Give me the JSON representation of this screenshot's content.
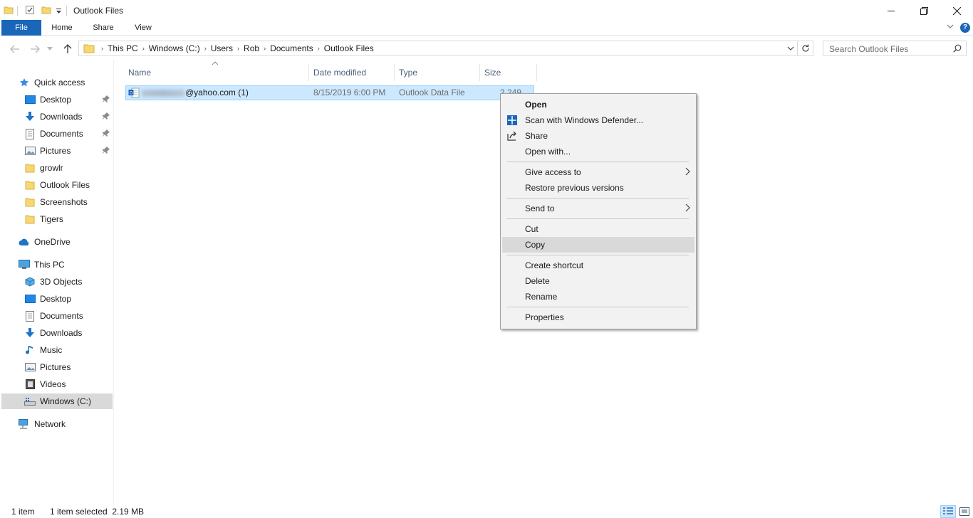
{
  "window": {
    "title": "Outlook Files"
  },
  "ribbon": {
    "tabs": [
      "File",
      "Home",
      "Share",
      "View"
    ],
    "help_label": "?"
  },
  "address": {
    "crumbs": [
      "This PC",
      "Windows (C:)",
      "Users",
      "Rob",
      "Documents",
      "Outlook Files"
    ],
    "separator": "›"
  },
  "search": {
    "placeholder": "Search Outlook Files"
  },
  "nav": {
    "quick_access": "Quick access",
    "quick_items": [
      "Desktop",
      "Downloads",
      "Documents",
      "Pictures",
      "growlr",
      "Outlook Files",
      "Screenshots",
      "Tigers"
    ],
    "onedrive": "OneDrive",
    "this_pc": "This PC",
    "pc_items": [
      "3D Objects",
      "Desktop",
      "Documents",
      "Downloads",
      "Music",
      "Pictures",
      "Videos",
      "Windows (C:)"
    ],
    "network": "Network"
  },
  "columns": {
    "name": "Name",
    "date": "Date modified",
    "type": "Type",
    "size": "Size"
  },
  "file": {
    "name_suffix": "@yahoo.com (1)",
    "date": "8/15/2019 6:00 PM",
    "type": "Outlook Data File",
    "size": "2,249 KB"
  },
  "context_menu": {
    "items": [
      "Open",
      "Scan with Windows Defender...",
      "Share",
      "Open with...",
      "Give access to",
      "Restore previous versions",
      "Send to",
      "Cut",
      "Copy",
      "Create shortcut",
      "Delete",
      "Rename",
      "Properties"
    ],
    "hovered": "Copy"
  },
  "status": {
    "count": "1 item",
    "selected": "1 item selected  2.19 MB"
  },
  "colors": {
    "accent": "#1a66b8",
    "selection": "#cce8ff",
    "menu_bg": "#f2f2f2"
  }
}
